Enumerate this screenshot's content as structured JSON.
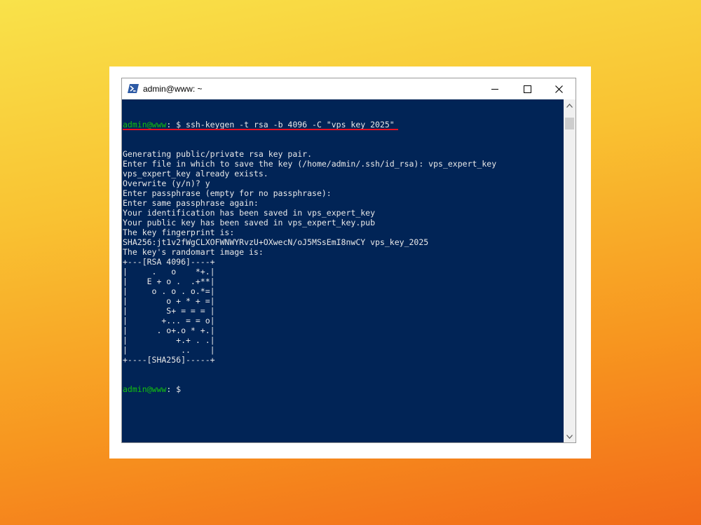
{
  "window": {
    "title": "admin@www: ~",
    "icon": "powershell-icon"
  },
  "controls": {
    "minimize_icon": "minimize-icon",
    "maximize_icon": "maximize-icon",
    "close_icon": "close-icon"
  },
  "terminal": {
    "prompt_user": "admin@www",
    "prompt_suffix": ": $ ",
    "command": "ssh-keygen -t rsa -b 4096 -C \"vps_key_2025\"",
    "output": [
      "Generating public/private rsa key pair.",
      "Enter file in which to save the key (/home/admin/.ssh/id_rsa): vps_expert_key",
      "vps_expert_key already exists.",
      "Overwrite (y/n)? y",
      "Enter passphrase (empty for no passphrase):",
      "Enter same passphrase again:",
      "Your identification has been saved in vps_expert_key",
      "Your public key has been saved in vps_expert_key.pub",
      "The key fingerprint is:",
      "SHA256:jt1v2fWgCLXOFWNWYRvzU+OXwecN/oJ5MSsEmI8nwCY vps_key_2025",
      "The key's randomart image is:",
      "+---[RSA 4096]----+",
      "|     .   o    *+.|",
      "|    E + o .  .+**|",
      "|     o . o . o.*=|",
      "|        o + * + =|",
      "|        S+ = = = |",
      "|       +... = = o|",
      "|      . o+.o * +.|",
      "|          +.+ . .|",
      "|           ..    |",
      "+----[SHA256]-----+"
    ],
    "final_prompt_user": "admin@www",
    "final_prompt_suffix": ": $ "
  },
  "colors": {
    "console_bg": "#012456",
    "prompt_green": "#13c10e",
    "underline_red": "#e81123"
  }
}
